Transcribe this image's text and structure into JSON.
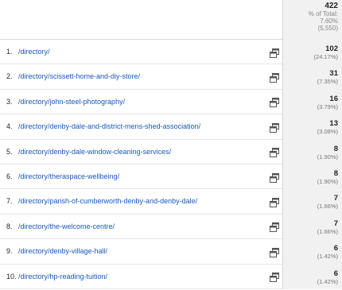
{
  "header": {
    "total_value": "422",
    "total_label": "% of Total:",
    "total_pct": "7.60%",
    "total_abs": "(5,550)"
  },
  "rows": [
    {
      "rank": "1.",
      "page": "/directory/",
      "value": "102",
      "pct": "(24.17%)"
    },
    {
      "rank": "2.",
      "page": "/directory/scissett-home-and-diy-store/",
      "value": "31",
      "pct": "(7.35%)"
    },
    {
      "rank": "3.",
      "page": "/directory/john-steel-photography/",
      "value": "16",
      "pct": "(3.79%)"
    },
    {
      "rank": "4.",
      "page": "/directory/denby-dale-and-district-mens-shed-association/",
      "value": "13",
      "pct": "(3.08%)"
    },
    {
      "rank": "5.",
      "page": "/directory/denby-dale-window-cleaning-services/",
      "value": "8",
      "pct": "(1.90%)"
    },
    {
      "rank": "6.",
      "page": "/directory/theraspace-wellbeing/",
      "value": "8",
      "pct": "(1.90%)"
    },
    {
      "rank": "7.",
      "page": "/directory/parish-of-cumberworth-denby-and-denby-dale/",
      "value": "7",
      "pct": "(1.66%)"
    },
    {
      "rank": "8.",
      "page": "/directory/the-welcome-centre/",
      "value": "7",
      "pct": "(1.66%)"
    },
    {
      "rank": "9.",
      "page": "/directory/denby-village-hall/",
      "value": "6",
      "pct": "(1.42%)"
    },
    {
      "rank": "10.",
      "page": "/directory/hp-reading-tuition/",
      "value": "6",
      "pct": "(1.42%)"
    }
  ],
  "icons": {
    "row_action": "open-in-new-window-icon"
  },
  "colors": {
    "link": "#1a58bd",
    "metric_bg": "#f1f1f1",
    "border": "#d8d8d8"
  }
}
